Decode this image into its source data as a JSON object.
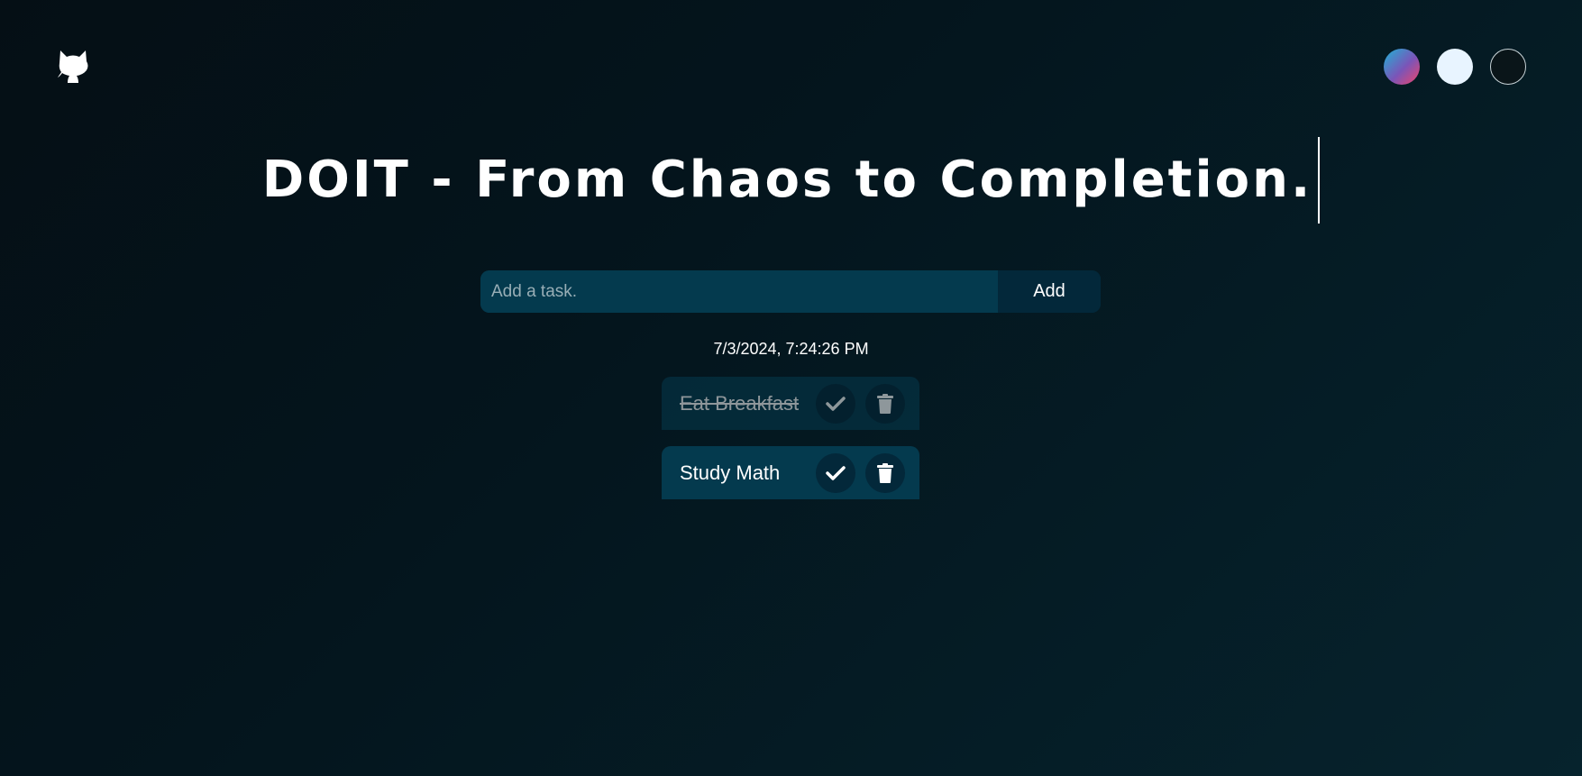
{
  "header": {
    "github_icon": "github-icon",
    "theme_switches": [
      {
        "name": "gradient-theme",
        "colors": [
          "#1fb3d6",
          "#7a55b8",
          "#f0446a"
        ]
      },
      {
        "name": "light-theme",
        "color": "#e8f4ff"
      },
      {
        "name": "dark-theme",
        "color": "#0a1519"
      }
    ]
  },
  "title": "DOIT - From Chaos to Completion.",
  "form": {
    "input_placeholder": "Add a task.",
    "input_value": "",
    "add_label": "Add"
  },
  "datetime": "7/3/2024, 7:24:26 PM",
  "todos": [
    {
      "text": "Eat Breakfast",
      "completed": true,
      "check_icon": "check-icon",
      "delete_icon": "trash-icon"
    },
    {
      "text": "Study Math",
      "completed": false,
      "check_icon": "check-icon",
      "delete_icon": "trash-icon"
    }
  ],
  "colors": {
    "background": "#04151d",
    "input_bg": "#043a4e",
    "button_bg": "#03283a",
    "text": "#ffffff"
  }
}
